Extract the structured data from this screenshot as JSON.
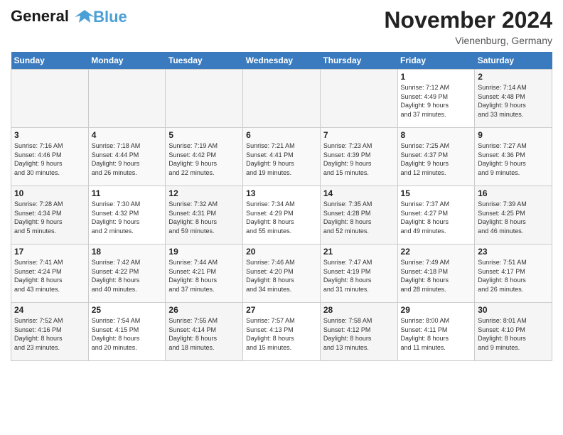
{
  "header": {
    "logo_line1": "General",
    "logo_line2": "Blue",
    "month_title": "November 2024",
    "location": "Vienenburg, Germany"
  },
  "days_of_week": [
    "Sunday",
    "Monday",
    "Tuesday",
    "Wednesday",
    "Thursday",
    "Friday",
    "Saturday"
  ],
  "weeks": [
    [
      {
        "day": "",
        "info": ""
      },
      {
        "day": "",
        "info": ""
      },
      {
        "day": "",
        "info": ""
      },
      {
        "day": "",
        "info": ""
      },
      {
        "day": "",
        "info": ""
      },
      {
        "day": "1",
        "info": "Sunrise: 7:12 AM\nSunset: 4:49 PM\nDaylight: 9 hours\nand 37 minutes."
      },
      {
        "day": "2",
        "info": "Sunrise: 7:14 AM\nSunset: 4:48 PM\nDaylight: 9 hours\nand 33 minutes."
      }
    ],
    [
      {
        "day": "3",
        "info": "Sunrise: 7:16 AM\nSunset: 4:46 PM\nDaylight: 9 hours\nand 30 minutes."
      },
      {
        "day": "4",
        "info": "Sunrise: 7:18 AM\nSunset: 4:44 PM\nDaylight: 9 hours\nand 26 minutes."
      },
      {
        "day": "5",
        "info": "Sunrise: 7:19 AM\nSunset: 4:42 PM\nDaylight: 9 hours\nand 22 minutes."
      },
      {
        "day": "6",
        "info": "Sunrise: 7:21 AM\nSunset: 4:41 PM\nDaylight: 9 hours\nand 19 minutes."
      },
      {
        "day": "7",
        "info": "Sunrise: 7:23 AM\nSunset: 4:39 PM\nDaylight: 9 hours\nand 15 minutes."
      },
      {
        "day": "8",
        "info": "Sunrise: 7:25 AM\nSunset: 4:37 PM\nDaylight: 9 hours\nand 12 minutes."
      },
      {
        "day": "9",
        "info": "Sunrise: 7:27 AM\nSunset: 4:36 PM\nDaylight: 9 hours\nand 9 minutes."
      }
    ],
    [
      {
        "day": "10",
        "info": "Sunrise: 7:28 AM\nSunset: 4:34 PM\nDaylight: 9 hours\nand 5 minutes."
      },
      {
        "day": "11",
        "info": "Sunrise: 7:30 AM\nSunset: 4:32 PM\nDaylight: 9 hours\nand 2 minutes."
      },
      {
        "day": "12",
        "info": "Sunrise: 7:32 AM\nSunset: 4:31 PM\nDaylight: 8 hours\nand 59 minutes."
      },
      {
        "day": "13",
        "info": "Sunrise: 7:34 AM\nSunset: 4:29 PM\nDaylight: 8 hours\nand 55 minutes."
      },
      {
        "day": "14",
        "info": "Sunrise: 7:35 AM\nSunset: 4:28 PM\nDaylight: 8 hours\nand 52 minutes."
      },
      {
        "day": "15",
        "info": "Sunrise: 7:37 AM\nSunset: 4:27 PM\nDaylight: 8 hours\nand 49 minutes."
      },
      {
        "day": "16",
        "info": "Sunrise: 7:39 AM\nSunset: 4:25 PM\nDaylight: 8 hours\nand 46 minutes."
      }
    ],
    [
      {
        "day": "17",
        "info": "Sunrise: 7:41 AM\nSunset: 4:24 PM\nDaylight: 8 hours\nand 43 minutes."
      },
      {
        "day": "18",
        "info": "Sunrise: 7:42 AM\nSunset: 4:22 PM\nDaylight: 8 hours\nand 40 minutes."
      },
      {
        "day": "19",
        "info": "Sunrise: 7:44 AM\nSunset: 4:21 PM\nDaylight: 8 hours\nand 37 minutes."
      },
      {
        "day": "20",
        "info": "Sunrise: 7:46 AM\nSunset: 4:20 PM\nDaylight: 8 hours\nand 34 minutes."
      },
      {
        "day": "21",
        "info": "Sunrise: 7:47 AM\nSunset: 4:19 PM\nDaylight: 8 hours\nand 31 minutes."
      },
      {
        "day": "22",
        "info": "Sunrise: 7:49 AM\nSunset: 4:18 PM\nDaylight: 8 hours\nand 28 minutes."
      },
      {
        "day": "23",
        "info": "Sunrise: 7:51 AM\nSunset: 4:17 PM\nDaylight: 8 hours\nand 26 minutes."
      }
    ],
    [
      {
        "day": "24",
        "info": "Sunrise: 7:52 AM\nSunset: 4:16 PM\nDaylight: 8 hours\nand 23 minutes."
      },
      {
        "day": "25",
        "info": "Sunrise: 7:54 AM\nSunset: 4:15 PM\nDaylight: 8 hours\nand 20 minutes."
      },
      {
        "day": "26",
        "info": "Sunrise: 7:55 AM\nSunset: 4:14 PM\nDaylight: 8 hours\nand 18 minutes."
      },
      {
        "day": "27",
        "info": "Sunrise: 7:57 AM\nSunset: 4:13 PM\nDaylight: 8 hours\nand 15 minutes."
      },
      {
        "day": "28",
        "info": "Sunrise: 7:58 AM\nSunset: 4:12 PM\nDaylight: 8 hours\nand 13 minutes."
      },
      {
        "day": "29",
        "info": "Sunrise: 8:00 AM\nSunset: 4:11 PM\nDaylight: 8 hours\nand 11 minutes."
      },
      {
        "day": "30",
        "info": "Sunrise: 8:01 AM\nSunset: 4:10 PM\nDaylight: 8 hours\nand 9 minutes."
      }
    ]
  ]
}
